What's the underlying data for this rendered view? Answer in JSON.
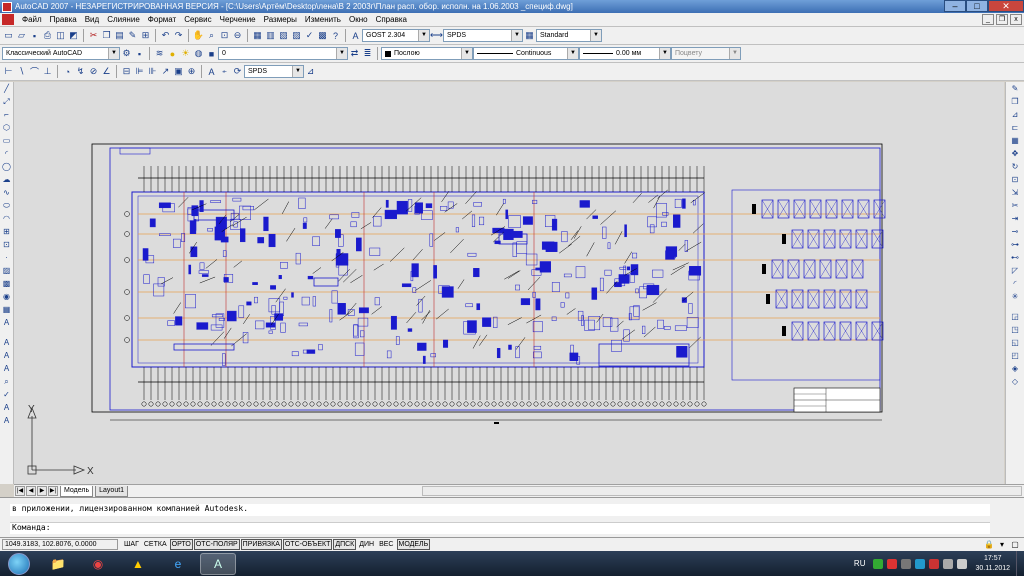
{
  "window": {
    "title": "AutoCAD 2007 - НЕЗАРЕГИСТРИРОВАННАЯ ВЕРСИЯ - [C:\\Users\\Артём\\Desktop\\лена\\В 2 2003г\\План расп. обор. исполн. на 1.06.2003 _специф.dwg]"
  },
  "menu": [
    "Файл",
    "Правка",
    "Вид",
    "Слияние",
    "Формат",
    "Сервис",
    "Черчение",
    "Размеры",
    "Изменить",
    "Окно",
    "Справка"
  ],
  "toolbar1": {
    "text_style": "GOST 2.304",
    "dim_style": "SPDS",
    "table_style": "Standard"
  },
  "toolbar2": {
    "workspace": "Классический AutoCAD",
    "layer": "0",
    "color": "Послою",
    "linetype": "Continuous",
    "lineweight": "0.00 мм",
    "plotstyle": "Поцвету"
  },
  "toolbar3": {
    "dim_style": "SPDS"
  },
  "tabs": [
    "Модель",
    "Layout1"
  ],
  "ucs": {
    "x_label": "X",
    "y_label": "Y"
  },
  "command": {
    "history": "в приложении, лицензированном компанией Autodesk.",
    "prompt": "Команда:"
  },
  "status": {
    "coords": "1049.3183, 102.8076, 0.0000",
    "buttons": [
      "ШАГ",
      "СЕТКА",
      "ОРТО",
      "ОТС-ПОЛЯР",
      "ПРИВЯЗКА",
      "ОТС-ОБЪЕКТ",
      "ДПСК",
      "ДИН",
      "ВЕС",
      "МОДЕЛЬ"
    ]
  },
  "taskbar": {
    "lang": "RU",
    "time": "17:57",
    "date": "30.11.2012"
  },
  "colors": {
    "drawing_blue": "#1a1acd",
    "drawing_orange": "#e8a050",
    "drawing_red": "#c03030",
    "canvas": "#dcdcdc"
  }
}
